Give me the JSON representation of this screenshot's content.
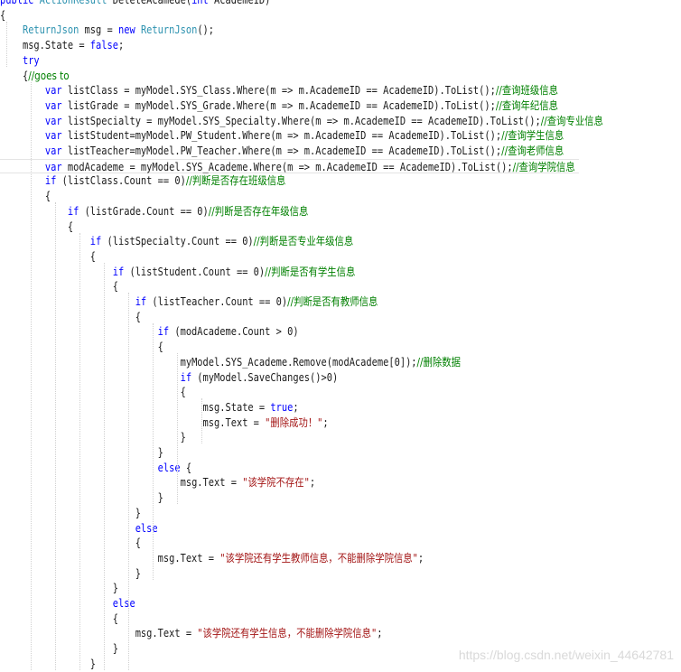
{
  "editor": {
    "lines": [
      {
        "indent": "",
        "segments": [
          {
            "t": "kw",
            "v": "public "
          },
          {
            "t": "ty",
            "v": "ActionResult "
          },
          {
            "t": "pl",
            "v": "DeleteAcamede("
          },
          {
            "t": "kw",
            "v": "int "
          },
          {
            "t": "pl",
            "v": "AcademeID)"
          }
        ]
      },
      {
        "indent": "",
        "segments": [
          {
            "t": "pl",
            "v": "{"
          }
        ]
      },
      {
        "indent": "    ",
        "segments": [
          {
            "t": "ty",
            "v": "ReturnJson"
          },
          {
            "t": "pl",
            "v": " msg = "
          },
          {
            "t": "kw",
            "v": "new "
          },
          {
            "t": "ty",
            "v": "ReturnJson"
          },
          {
            "t": "pl",
            "v": "();"
          }
        ]
      },
      {
        "indent": "    ",
        "segments": [
          {
            "t": "pl",
            "v": "msg.State = "
          },
          {
            "t": "kw",
            "v": "false"
          },
          {
            "t": "pl",
            "v": ";"
          }
        ]
      },
      {
        "indent": "    ",
        "segments": [
          {
            "t": "kw",
            "v": "try"
          }
        ]
      },
      {
        "indent": "    ",
        "segments": [
          {
            "t": "pl",
            "v": "{"
          },
          {
            "t": "cm",
            "v": "//goes to"
          }
        ]
      },
      {
        "indent": "        ",
        "segments": [
          {
            "t": "kw",
            "v": "var "
          },
          {
            "t": "pl",
            "v": "listClass = myModel.SYS_Class.Where(m => m.AcademeID == AcademeID).ToList();"
          },
          {
            "t": "cm",
            "v": "//查询班级信息"
          }
        ]
      },
      {
        "indent": "        ",
        "segments": [
          {
            "t": "kw",
            "v": "var "
          },
          {
            "t": "pl",
            "v": "listGrade = myModel.SYS_Grade.Where(m => m.AcademeID == AcademeID).ToList();"
          },
          {
            "t": "cm",
            "v": "//查询年纪信息"
          }
        ]
      },
      {
        "indent": "        ",
        "segments": [
          {
            "t": "kw",
            "v": "var "
          },
          {
            "t": "pl",
            "v": "listSpecialty = myModel.SYS_Specialty.Where(m => m.AcademeID == AcademeID).ToList();"
          },
          {
            "t": "cm",
            "v": "//查询专业信息"
          }
        ]
      },
      {
        "indent": "        ",
        "segments": [
          {
            "t": "kw",
            "v": "var "
          },
          {
            "t": "pl",
            "v": "listStudent=myModel.PW_Student.Where(m => m.AcademeID == AcademeID).ToList();"
          },
          {
            "t": "cm",
            "v": "//查询学生信息"
          }
        ]
      },
      {
        "indent": "        ",
        "segments": [
          {
            "t": "kw",
            "v": "var "
          },
          {
            "t": "pl",
            "v": "listTeacher=myModel.PW_Teacher.Where(m => m.AcademeID == AcademeID).ToList();"
          },
          {
            "t": "cm",
            "v": "//查询老师信息"
          }
        ]
      },
      {
        "indent": "        ",
        "current": true,
        "segments": [
          {
            "t": "kw",
            "v": "var "
          },
          {
            "t": "pl",
            "v": "modAcademe = myModel.SYS_Academe.Where(m => m.AcademeID == AcademeID).ToList();"
          },
          {
            "t": "cm",
            "v": "//查询学院信息"
          }
        ]
      },
      {
        "indent": "        ",
        "segments": [
          {
            "t": "kw",
            "v": "if "
          },
          {
            "t": "pl",
            "v": "(listClass.Count == 0)"
          },
          {
            "t": "cm",
            "v": "//判断是否存在班级信息"
          }
        ]
      },
      {
        "indent": "        ",
        "segments": [
          {
            "t": "pl",
            "v": "{"
          }
        ]
      },
      {
        "indent": "            ",
        "segments": [
          {
            "t": "kw",
            "v": "if "
          },
          {
            "t": "pl",
            "v": "(listGrade.Count == 0)"
          },
          {
            "t": "cm",
            "v": "//判断是否存在年级信息"
          }
        ]
      },
      {
        "indent": "            ",
        "segments": [
          {
            "t": "pl",
            "v": "{"
          }
        ]
      },
      {
        "indent": "                ",
        "segments": [
          {
            "t": "kw",
            "v": "if "
          },
          {
            "t": "pl",
            "v": "(listSpecialty.Count == 0)"
          },
          {
            "t": "cm",
            "v": "//判断是否专业年级信息"
          }
        ]
      },
      {
        "indent": "                ",
        "segments": [
          {
            "t": "pl",
            "v": "{"
          }
        ]
      },
      {
        "indent": "                    ",
        "segments": [
          {
            "t": "kw",
            "v": "if "
          },
          {
            "t": "pl",
            "v": "(listStudent.Count == 0)"
          },
          {
            "t": "cm",
            "v": "//判断是否有学生信息"
          }
        ]
      },
      {
        "indent": "                    ",
        "segments": [
          {
            "t": "pl",
            "v": "{"
          }
        ]
      },
      {
        "indent": "                        ",
        "segments": [
          {
            "t": "kw",
            "v": "if "
          },
          {
            "t": "pl",
            "v": "(listTeacher.Count == 0)"
          },
          {
            "t": "cm",
            "v": "//判断是否有教师信息"
          }
        ]
      },
      {
        "indent": "                        ",
        "segments": [
          {
            "t": "pl",
            "v": "{"
          }
        ]
      },
      {
        "indent": "                            ",
        "segments": [
          {
            "t": "kw",
            "v": "if "
          },
          {
            "t": "pl",
            "v": "(modAcademe.Count > 0)"
          }
        ]
      },
      {
        "indent": "                            ",
        "segments": [
          {
            "t": "pl",
            "v": "{"
          }
        ]
      },
      {
        "indent": "                                ",
        "segments": [
          {
            "t": "pl",
            "v": "myModel.SYS_Academe.Remove(modAcademe[0]);"
          },
          {
            "t": "cm",
            "v": "//删除数据"
          }
        ]
      },
      {
        "indent": "                                ",
        "segments": [
          {
            "t": "kw",
            "v": "if "
          },
          {
            "t": "pl",
            "v": "(myModel.SaveChanges()>0)"
          }
        ]
      },
      {
        "indent": "                                ",
        "segments": [
          {
            "t": "pl",
            "v": "{"
          }
        ]
      },
      {
        "indent": "                                    ",
        "segments": [
          {
            "t": "pl",
            "v": "msg.State = "
          },
          {
            "t": "kw",
            "v": "true"
          },
          {
            "t": "pl",
            "v": ";"
          }
        ]
      },
      {
        "indent": "                                    ",
        "segments": [
          {
            "t": "pl",
            "v": "msg.Text = "
          },
          {
            "t": "st",
            "v": "\"删除成功！\""
          },
          {
            "t": "pl",
            "v": ";"
          }
        ]
      },
      {
        "indent": "                                ",
        "segments": [
          {
            "t": "pl",
            "v": "}"
          }
        ]
      },
      {
        "indent": "                            ",
        "segments": [
          {
            "t": "pl",
            "v": "}"
          }
        ]
      },
      {
        "indent": "                            ",
        "segments": [
          {
            "t": "kw",
            "v": "else "
          },
          {
            "t": "pl",
            "v": "{"
          }
        ]
      },
      {
        "indent": "                                ",
        "segments": [
          {
            "t": "pl",
            "v": "msg.Text = "
          },
          {
            "t": "st",
            "v": "\"该学院不存在\""
          },
          {
            "t": "pl",
            "v": ";"
          }
        ]
      },
      {
        "indent": "                            ",
        "segments": [
          {
            "t": "pl",
            "v": "}"
          }
        ]
      },
      {
        "indent": "                        ",
        "segments": [
          {
            "t": "pl",
            "v": "}"
          }
        ]
      },
      {
        "indent": "                        ",
        "segments": [
          {
            "t": "kw",
            "v": "else"
          }
        ]
      },
      {
        "indent": "                        ",
        "segments": [
          {
            "t": "pl",
            "v": "{"
          }
        ]
      },
      {
        "indent": "                            ",
        "segments": [
          {
            "t": "pl",
            "v": "msg.Text = "
          },
          {
            "t": "st",
            "v": "\"该学院还有学生教师信息，不能删除学院信息\""
          },
          {
            "t": "pl",
            "v": ";"
          }
        ]
      },
      {
        "indent": "                        ",
        "segments": [
          {
            "t": "pl",
            "v": "}"
          }
        ]
      },
      {
        "indent": "                    ",
        "segments": [
          {
            "t": "pl",
            "v": "}"
          }
        ]
      },
      {
        "indent": "                    ",
        "segments": [
          {
            "t": "kw",
            "v": "else"
          }
        ]
      },
      {
        "indent": "                    ",
        "segments": [
          {
            "t": "pl",
            "v": "{"
          }
        ]
      },
      {
        "indent": "                        ",
        "segments": [
          {
            "t": "pl",
            "v": "msg.Text = "
          },
          {
            "t": "st",
            "v": "\"该学院还有学生信息，不能删除学院信息\""
          },
          {
            "t": "pl",
            "v": ";"
          }
        ]
      },
      {
        "indent": "                    ",
        "segments": [
          {
            "t": "pl",
            "v": "}"
          }
        ]
      },
      {
        "indent": "                ",
        "segments": [
          {
            "t": "pl",
            "v": "}"
          }
        ]
      }
    ]
  },
  "watermark": "https://blog.csdn.net/weixin_44642781",
  "colors": {
    "keyword": "#0000ff",
    "type": "#2b91af",
    "comment": "#008000",
    "string": "#a31515",
    "text": "#1a1a1a"
  }
}
